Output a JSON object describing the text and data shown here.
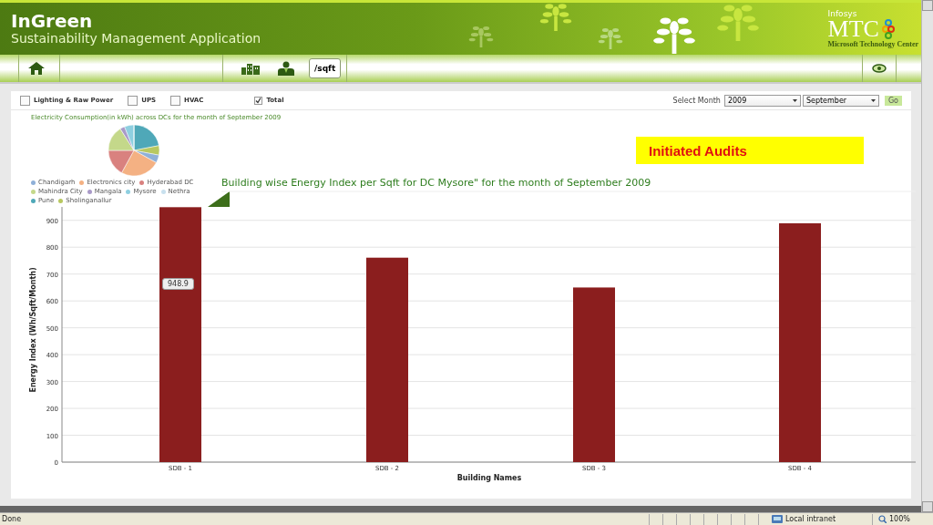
{
  "header": {
    "title": "InGreen",
    "subtitle": "Sustainability Management Application",
    "logo": {
      "brand": "Infosys",
      "name": "MTC",
      "caption": "Microsoft Technology Center"
    }
  },
  "nav": {
    "items": [
      {
        "kind": "home",
        "selected": false
      },
      {
        "kind": "buildings",
        "selected": false
      },
      {
        "kind": "people",
        "selected": false
      },
      {
        "kind": "text",
        "label": "/sqft",
        "selected": true
      }
    ]
  },
  "filters": [
    {
      "label": "Lighting  & Raw Power",
      "checked": false
    },
    {
      "label": "UPS",
      "checked": false
    },
    {
      "label": "HVAC",
      "checked": false
    },
    {
      "label": "Total",
      "checked": true
    }
  ],
  "month_picker": {
    "label": "Select Month",
    "year": "2009",
    "month": "September",
    "go": "Go"
  },
  "pie": {
    "title": "Electricity Consumption(in kWh) across DCs for the month of September 2009",
    "legend": [
      {
        "name": "Chandigarh",
        "color": "#8fb0d8"
      },
      {
        "name": "Electronics city",
        "color": "#f4b183"
      },
      {
        "name": "Hyderabad DC",
        "color": "#d9817f"
      },
      {
        "name": "Mahindra City",
        "color": "#c4d88a"
      },
      {
        "name": "Mangala",
        "color": "#a99ac8"
      },
      {
        "name": "Mysore",
        "color": "#8ecfe0"
      },
      {
        "name": "Nethra",
        "color": "#c8e0ee"
      },
      {
        "name": "Pune",
        "color": "#4fa8b8"
      },
      {
        "name": "Sholinganallur",
        "color": "#b8c860"
      }
    ]
  },
  "callout": "Initiated Audits",
  "chart": {
    "tooltip": "948.9",
    "chart_data": {
      "type": "bar",
      "title": "Building wise Energy Index per Sqft for DC Mysore\" for the month of September 2009",
      "xlabel": "Building Names",
      "ylabel": "Energy Index (Wh/Sqft/Month)",
      "categories": [
        "SDB - 1",
        "SDB - 2",
        "SDB - 3",
        "SDB - 4"
      ],
      "values": [
        948.9,
        761,
        650,
        889
      ],
      "grid": true,
      "ylim": [
        0,
        950
      ],
      "yticks": [
        0,
        100,
        200,
        300,
        400,
        500,
        600,
        700,
        800,
        900
      ]
    }
  },
  "status_bar": {
    "text": "Done",
    "zone": "Local intranet",
    "zoom": "100%"
  }
}
